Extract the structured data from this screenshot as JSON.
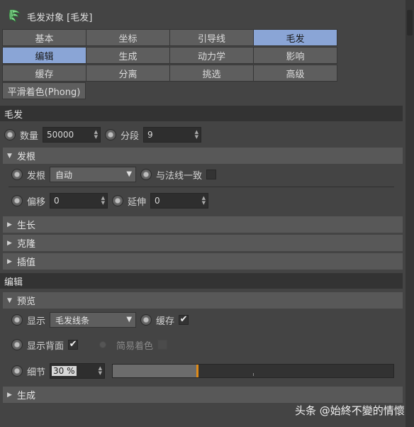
{
  "header": {
    "title": "毛发对象 [毛发]"
  },
  "tabs": {
    "row1": [
      "基本",
      "坐标",
      "引导线",
      "毛发"
    ],
    "row2": [
      "编辑",
      "生成",
      "动力学",
      "影响"
    ],
    "row3": [
      "缓存",
      "分离",
      "挑选",
      "高级"
    ],
    "row4": [
      "平滑着色(Phong)"
    ],
    "active": [
      "毛发",
      "编辑"
    ]
  },
  "hair": {
    "section_label": "毛发",
    "count_label": "数量",
    "count_value": "50000",
    "segments_label": "分段",
    "segments_value": "9",
    "root": {
      "group_label": "发根",
      "root_label": "发根",
      "root_value": "自动",
      "align_normal_label": "与法线一致",
      "align_normal_checked": false,
      "offset_label": "偏移",
      "offset_value": "0",
      "extend_label": "延伸",
      "extend_value": "0"
    },
    "groups_collapsed": [
      "生长",
      "克隆",
      "插值"
    ]
  },
  "edit": {
    "section_label": "编辑",
    "preview": {
      "group_label": "预览",
      "display_label": "显示",
      "display_value": "毛发线条",
      "cache_label": "缓存",
      "cache_checked": true,
      "backface_label": "显示背面",
      "backface_checked": true,
      "simple_shading_label": "简易着色",
      "simple_shading_checked": false,
      "detail_label": "细节",
      "detail_value": "30 %",
      "detail_fraction": 0.3
    },
    "generate_label": "生成"
  },
  "watermark": "头条 @始終不變的情懷",
  "icons": {
    "object": "hair-object-icon",
    "spinner": "spinner-arrows-icon",
    "dropdown": "dropdown-arrow-icon",
    "check": "checkmark-icon"
  },
  "colors": {
    "active_tab": "#8aa5d6",
    "slider_marker": "#e08a16",
    "panel_bg": "#444444"
  }
}
